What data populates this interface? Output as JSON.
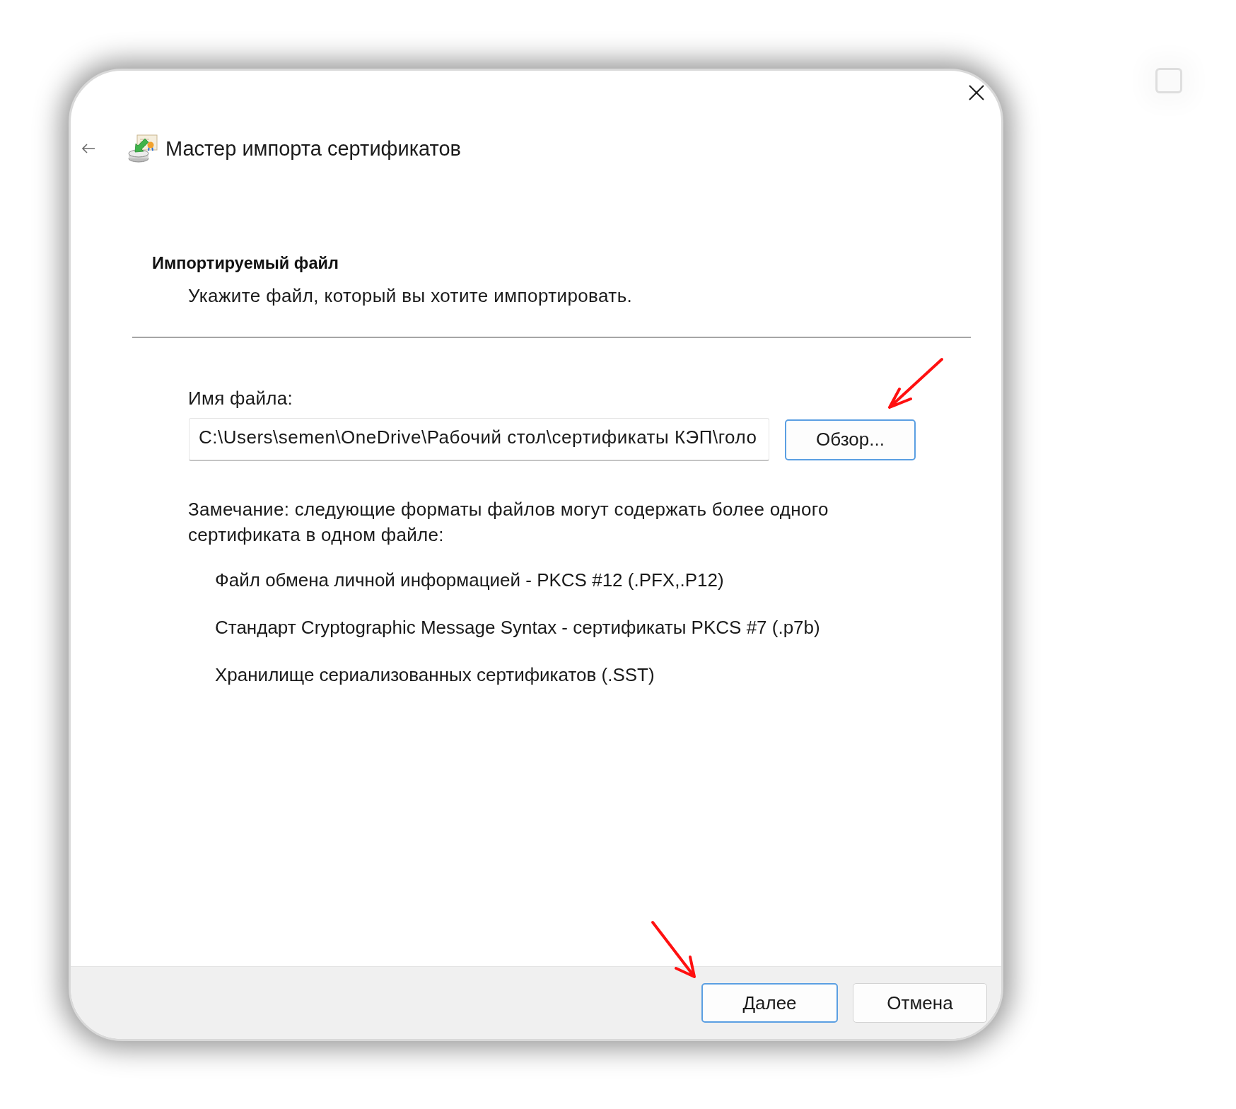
{
  "window": {
    "title": "Мастер импорта сертификатов"
  },
  "page": {
    "heading": "Импортируемый файл",
    "description": "Укажите файл, который вы хотите импортировать."
  },
  "file": {
    "label": "Имя файла:",
    "value": "C:\\Users\\semen\\OneDrive\\Рабочий стол\\сертификаты КЭП\\голо",
    "browse_button": {
      "label": "Обзор...",
      "highlighted": true,
      "arrow_marker": true
    }
  },
  "note": {
    "text": "Замечание: следующие форматы файлов могут содержать более одного сертификата в одном файле:",
    "formats": [
      "Файл обмена личной информацией - PKCS #12 (.PFX,.P12)",
      "Стандарт Cryptographic Message Syntax - сертификаты PKCS #7 (.p7b)",
      "Хранилище сериализованных сертификатов (.SST)"
    ]
  },
  "footer": {
    "buttons": [
      {
        "label": "Далее",
        "highlighted": true,
        "arrow_marker": true
      },
      {
        "label": "Отмена",
        "highlighted": false,
        "arrow_marker": false
      }
    ]
  }
}
